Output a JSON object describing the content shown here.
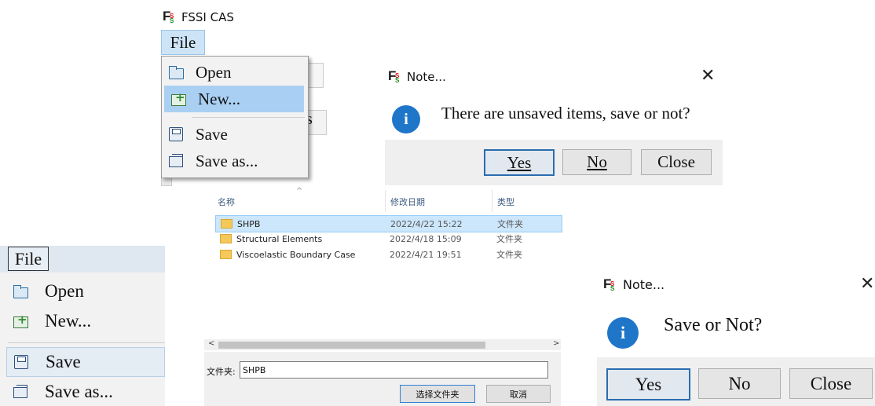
{
  "app": {
    "title": "FSSI CAS",
    "logo_text": "FSSI"
  },
  "menu_top": {
    "button_label": "File",
    "items": [
      {
        "label": "Open",
        "icon": "open-icon"
      },
      {
        "label": "New...",
        "icon": "new-icon",
        "highlighted": true
      },
      {
        "label": "Save",
        "icon": "save-icon"
      },
      {
        "label": "Save as...",
        "icon": "save-as-icon"
      }
    ],
    "behind_text": "s"
  },
  "menu_bottom": {
    "button_label": "File",
    "items": [
      {
        "label": "Open",
        "icon": "open-icon"
      },
      {
        "label": "New...",
        "icon": "new-icon"
      },
      {
        "label": "Save",
        "icon": "save-icon",
        "highlighted": true
      },
      {
        "label": "Save as...",
        "icon": "save-as-icon"
      }
    ]
  },
  "dialog_1": {
    "title": "Note...",
    "message": "There are unsaved items, save or not?",
    "buttons": {
      "yes": "Yes",
      "no": "No",
      "close": "Close"
    }
  },
  "dialog_2": {
    "title": "Note...",
    "message": "Save or Not?",
    "buttons": {
      "yes": "Yes",
      "no": "No",
      "close": "Close"
    }
  },
  "file_chooser": {
    "columns": {
      "name": "名称",
      "date": "修改日期",
      "type": "类型"
    },
    "rows": [
      {
        "name": "SHPB",
        "date": "2022/4/22 15:22",
        "type": "文件夹",
        "selected": true
      },
      {
        "name": "Structural Elements",
        "date": "2022/4/18 15:09",
        "type": "文件夹"
      },
      {
        "name": "Viscoelastic Boundary Case",
        "date": "2022/4/21 19:51",
        "type": "文件夹"
      }
    ],
    "folder_label": "文件夹:",
    "folder_value": "SHPB",
    "select_button": "选择文件夹",
    "cancel_button": "取消"
  },
  "colors": {
    "accent": "#1f76c9",
    "highlight": "#a9d0f3",
    "selection": "#cce6fb"
  }
}
